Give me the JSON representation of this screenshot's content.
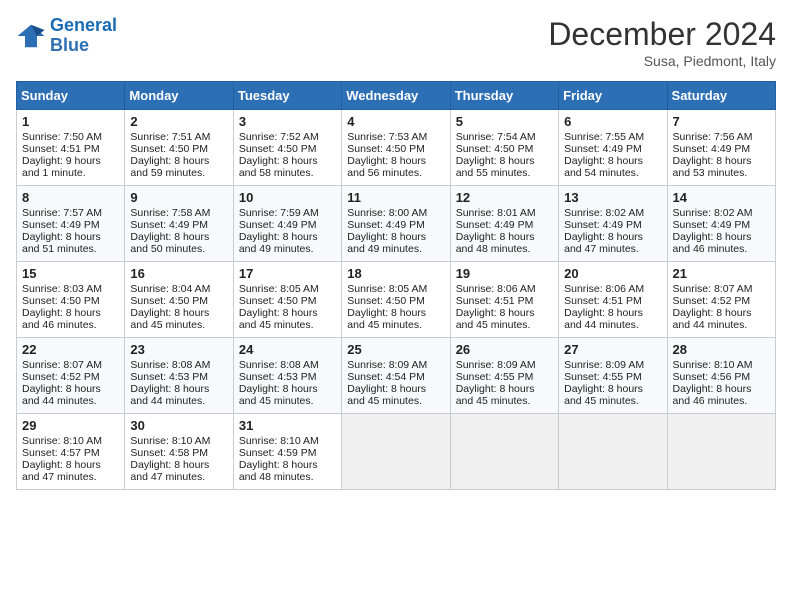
{
  "header": {
    "logo_line1": "General",
    "logo_line2": "Blue",
    "month": "December 2024",
    "location": "Susa, Piedmont, Italy"
  },
  "days_of_week": [
    "Sunday",
    "Monday",
    "Tuesday",
    "Wednesday",
    "Thursday",
    "Friday",
    "Saturday"
  ],
  "weeks": [
    [
      {
        "day": "1",
        "lines": [
          "Sunrise: 7:50 AM",
          "Sunset: 4:51 PM",
          "Daylight: 9 hours",
          "and 1 minute."
        ]
      },
      {
        "day": "2",
        "lines": [
          "Sunrise: 7:51 AM",
          "Sunset: 4:50 PM",
          "Daylight: 8 hours",
          "and 59 minutes."
        ]
      },
      {
        "day": "3",
        "lines": [
          "Sunrise: 7:52 AM",
          "Sunset: 4:50 PM",
          "Daylight: 8 hours",
          "and 58 minutes."
        ]
      },
      {
        "day": "4",
        "lines": [
          "Sunrise: 7:53 AM",
          "Sunset: 4:50 PM",
          "Daylight: 8 hours",
          "and 56 minutes."
        ]
      },
      {
        "day": "5",
        "lines": [
          "Sunrise: 7:54 AM",
          "Sunset: 4:50 PM",
          "Daylight: 8 hours",
          "and 55 minutes."
        ]
      },
      {
        "day": "6",
        "lines": [
          "Sunrise: 7:55 AM",
          "Sunset: 4:49 PM",
          "Daylight: 8 hours",
          "and 54 minutes."
        ]
      },
      {
        "day": "7",
        "lines": [
          "Sunrise: 7:56 AM",
          "Sunset: 4:49 PM",
          "Daylight: 8 hours",
          "and 53 minutes."
        ]
      }
    ],
    [
      {
        "day": "8",
        "lines": [
          "Sunrise: 7:57 AM",
          "Sunset: 4:49 PM",
          "Daylight: 8 hours",
          "and 51 minutes."
        ]
      },
      {
        "day": "9",
        "lines": [
          "Sunrise: 7:58 AM",
          "Sunset: 4:49 PM",
          "Daylight: 8 hours",
          "and 50 minutes."
        ]
      },
      {
        "day": "10",
        "lines": [
          "Sunrise: 7:59 AM",
          "Sunset: 4:49 PM",
          "Daylight: 8 hours",
          "and 49 minutes."
        ]
      },
      {
        "day": "11",
        "lines": [
          "Sunrise: 8:00 AM",
          "Sunset: 4:49 PM",
          "Daylight: 8 hours",
          "and 49 minutes."
        ]
      },
      {
        "day": "12",
        "lines": [
          "Sunrise: 8:01 AM",
          "Sunset: 4:49 PM",
          "Daylight: 8 hours",
          "and 48 minutes."
        ]
      },
      {
        "day": "13",
        "lines": [
          "Sunrise: 8:02 AM",
          "Sunset: 4:49 PM",
          "Daylight: 8 hours",
          "and 47 minutes."
        ]
      },
      {
        "day": "14",
        "lines": [
          "Sunrise: 8:02 AM",
          "Sunset: 4:49 PM",
          "Daylight: 8 hours",
          "and 46 minutes."
        ]
      }
    ],
    [
      {
        "day": "15",
        "lines": [
          "Sunrise: 8:03 AM",
          "Sunset: 4:50 PM",
          "Daylight: 8 hours",
          "and 46 minutes."
        ]
      },
      {
        "day": "16",
        "lines": [
          "Sunrise: 8:04 AM",
          "Sunset: 4:50 PM",
          "Daylight: 8 hours",
          "and 45 minutes."
        ]
      },
      {
        "day": "17",
        "lines": [
          "Sunrise: 8:05 AM",
          "Sunset: 4:50 PM",
          "Daylight: 8 hours",
          "and 45 minutes."
        ]
      },
      {
        "day": "18",
        "lines": [
          "Sunrise: 8:05 AM",
          "Sunset: 4:50 PM",
          "Daylight: 8 hours",
          "and 45 minutes."
        ]
      },
      {
        "day": "19",
        "lines": [
          "Sunrise: 8:06 AM",
          "Sunset: 4:51 PM",
          "Daylight: 8 hours",
          "and 45 minutes."
        ]
      },
      {
        "day": "20",
        "lines": [
          "Sunrise: 8:06 AM",
          "Sunset: 4:51 PM",
          "Daylight: 8 hours",
          "and 44 minutes."
        ]
      },
      {
        "day": "21",
        "lines": [
          "Sunrise: 8:07 AM",
          "Sunset: 4:52 PM",
          "Daylight: 8 hours",
          "and 44 minutes."
        ]
      }
    ],
    [
      {
        "day": "22",
        "lines": [
          "Sunrise: 8:07 AM",
          "Sunset: 4:52 PM",
          "Daylight: 8 hours",
          "and 44 minutes."
        ]
      },
      {
        "day": "23",
        "lines": [
          "Sunrise: 8:08 AM",
          "Sunset: 4:53 PM",
          "Daylight: 8 hours",
          "and 44 minutes."
        ]
      },
      {
        "day": "24",
        "lines": [
          "Sunrise: 8:08 AM",
          "Sunset: 4:53 PM",
          "Daylight: 8 hours",
          "and 45 minutes."
        ]
      },
      {
        "day": "25",
        "lines": [
          "Sunrise: 8:09 AM",
          "Sunset: 4:54 PM",
          "Daylight: 8 hours",
          "and 45 minutes."
        ]
      },
      {
        "day": "26",
        "lines": [
          "Sunrise: 8:09 AM",
          "Sunset: 4:55 PM",
          "Daylight: 8 hours",
          "and 45 minutes."
        ]
      },
      {
        "day": "27",
        "lines": [
          "Sunrise: 8:09 AM",
          "Sunset: 4:55 PM",
          "Daylight: 8 hours",
          "and 45 minutes."
        ]
      },
      {
        "day": "28",
        "lines": [
          "Sunrise: 8:10 AM",
          "Sunset: 4:56 PM",
          "Daylight: 8 hours",
          "and 46 minutes."
        ]
      }
    ],
    [
      {
        "day": "29",
        "lines": [
          "Sunrise: 8:10 AM",
          "Sunset: 4:57 PM",
          "Daylight: 8 hours",
          "and 47 minutes."
        ]
      },
      {
        "day": "30",
        "lines": [
          "Sunrise: 8:10 AM",
          "Sunset: 4:58 PM",
          "Daylight: 8 hours",
          "and 47 minutes."
        ]
      },
      {
        "day": "31",
        "lines": [
          "Sunrise: 8:10 AM",
          "Sunset: 4:59 PM",
          "Daylight: 8 hours",
          "and 48 minutes."
        ]
      },
      null,
      null,
      null,
      null
    ]
  ]
}
